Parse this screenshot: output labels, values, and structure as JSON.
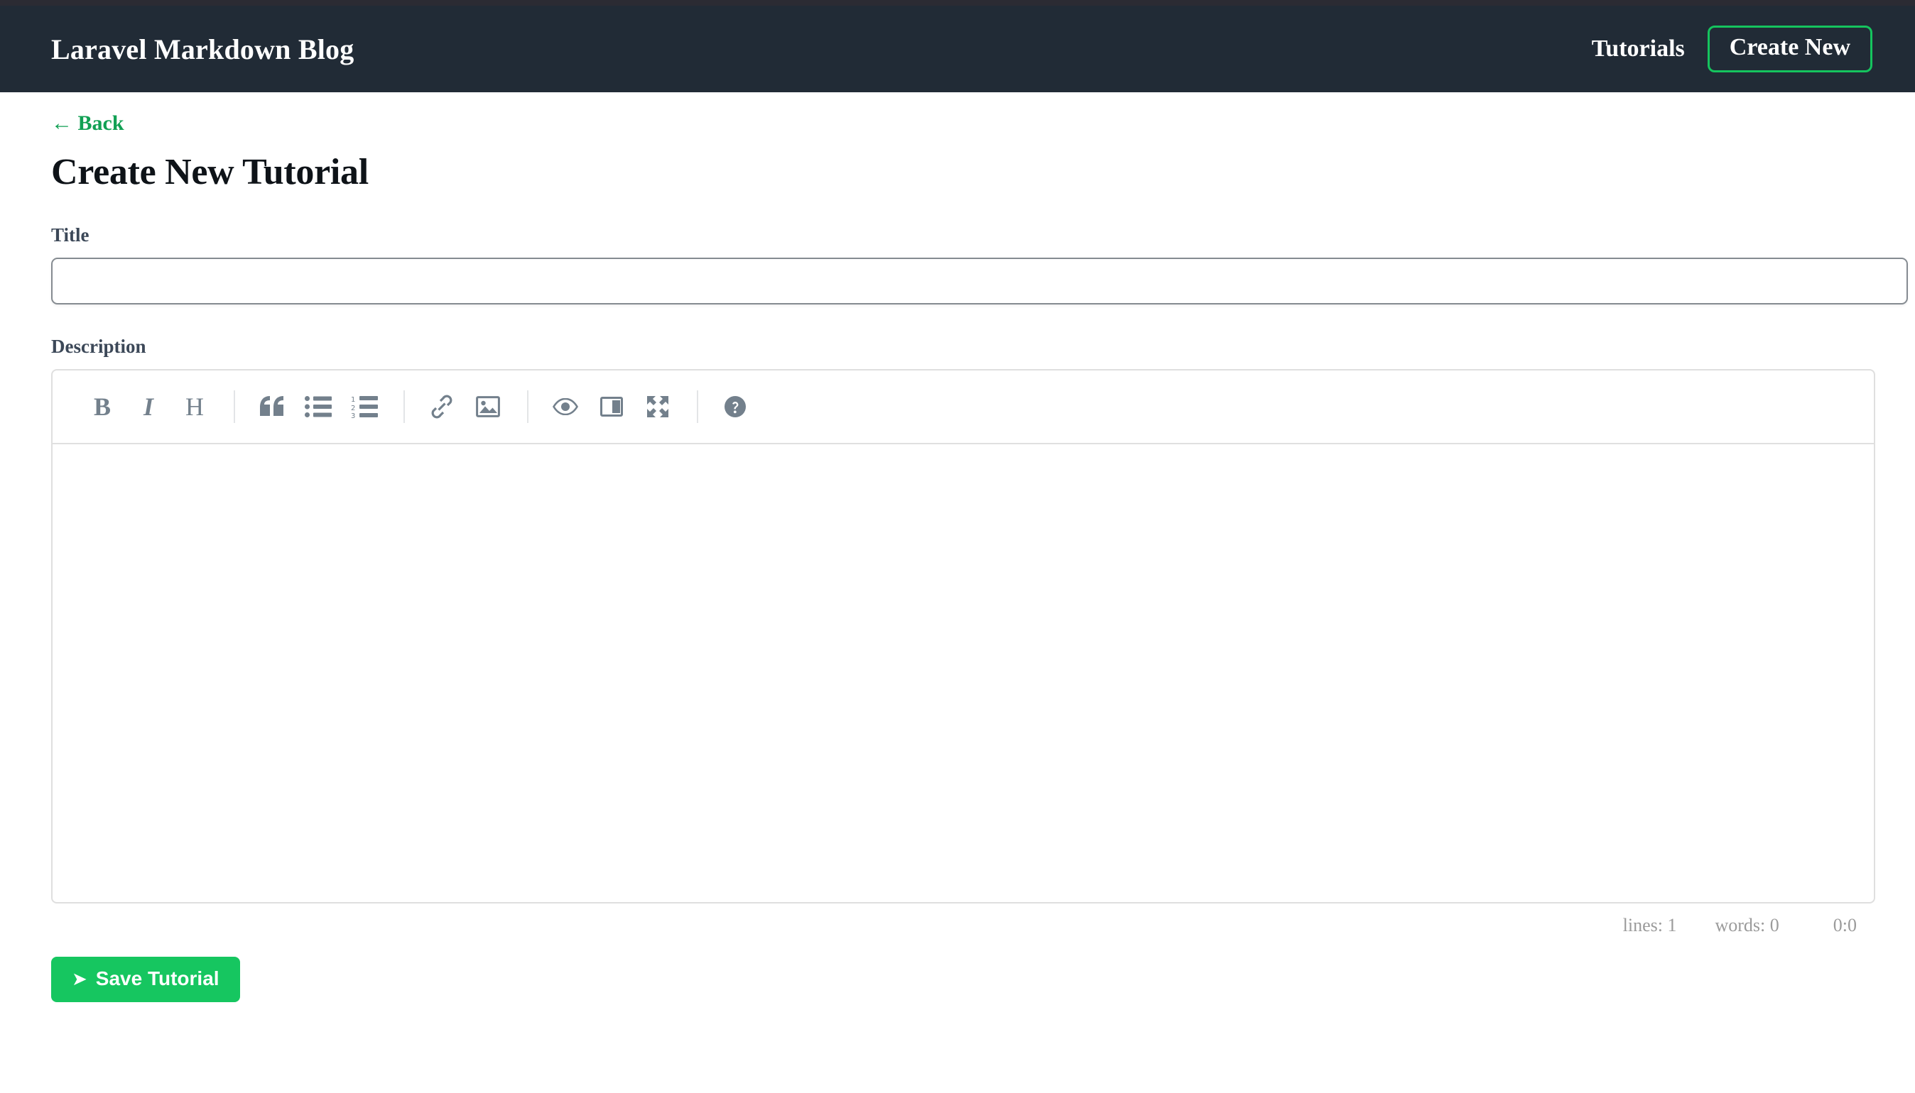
{
  "navbar": {
    "brand": "Laravel Markdown Blog",
    "links": [
      {
        "label": "Tutorials",
        "name": "nav-link-tutorials"
      }
    ],
    "cta": {
      "label": "Create New",
      "name": "nav-create-new-button"
    },
    "bg_color": "#212b36",
    "accent_color": "#15c45e"
  },
  "page": {
    "back_link": "← Back",
    "title": "Create New Tutorial",
    "link_color": "#11a053"
  },
  "form": {
    "title_field": {
      "label": "Title",
      "value": "",
      "placeholder": ""
    },
    "description_field": {
      "label": "Description",
      "value": "",
      "placeholder": ""
    },
    "save_button": {
      "icon": "➤",
      "label": "Save Tutorial",
      "color": "#16c660"
    }
  },
  "editor": {
    "toolbar": [
      {
        "name": "bold-icon",
        "title": "Bold",
        "glyph": "B"
      },
      {
        "name": "italic-icon",
        "title": "Italic",
        "glyph": "I"
      },
      {
        "name": "heading-icon",
        "title": "Heading",
        "glyph": "H"
      },
      {
        "name": "quote-icon",
        "title": "Quote",
        "glyph": "“"
      },
      {
        "name": "unordered-list-icon",
        "title": "Generic List",
        "glyph": ""
      },
      {
        "name": "ordered-list-icon",
        "title": "Numbered List",
        "glyph": ""
      },
      {
        "name": "link-icon",
        "title": "Create Link",
        "glyph": ""
      },
      {
        "name": "image-icon",
        "title": "Insert Image",
        "glyph": ""
      },
      {
        "name": "preview-icon",
        "title": "Toggle Preview",
        "glyph": ""
      },
      {
        "name": "side-by-side-icon",
        "title": "Toggle Side by Side",
        "glyph": ""
      },
      {
        "name": "fullscreen-icon",
        "title": "Toggle Fullscreen",
        "glyph": ""
      },
      {
        "name": "help-icon",
        "title": "Markdown Guide",
        "glyph": ""
      }
    ],
    "status": {
      "lines": "lines: 1",
      "words": "words: 0",
      "cursor": "0:0"
    },
    "icon_color": "#73808c",
    "border_color": "#dfdfdf"
  }
}
